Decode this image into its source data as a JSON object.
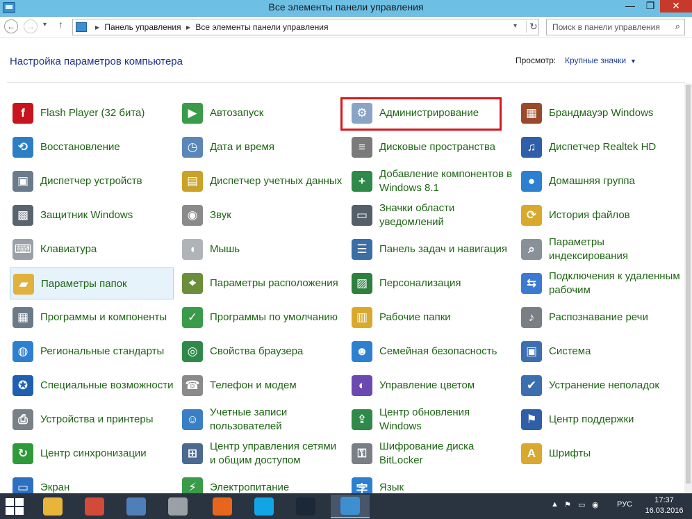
{
  "window": {
    "title": "Все элементы панели управления",
    "minimize": "—",
    "maximize": "❐",
    "close": "✕"
  },
  "nav": {
    "back": "←",
    "forward": "→",
    "recent": "▾",
    "up": "↑",
    "breadcrumb": [
      "Панель управления",
      "Все элементы панели управления"
    ],
    "breadcrumb_sep": "▸",
    "address_dropdown": "▾",
    "refresh": "↻",
    "search_placeholder": "Поиск в панели управления",
    "search_icon": "⌕"
  },
  "header": {
    "title": "Настройка параметров компьютера",
    "view_label": "Просмотр:",
    "view_value": "Крупные значки",
    "view_caret": "▼"
  },
  "items": [
    {
      "label": "Flash Player (32 бита)",
      "icon": "flash-player-icon",
      "color": "#c8141c",
      "glyph": "f"
    },
    {
      "label": "Автозапуск",
      "icon": "autoplay-icon",
      "color": "#3a9b48",
      "glyph": "▶"
    },
    {
      "label": "Администрирование",
      "icon": "administrative-tools-icon",
      "color": "#8aa4c8",
      "glyph": "⚙"
    },
    {
      "label": "Брандмауэр Windows",
      "icon": "firewall-icon",
      "color": "#9a4a2a",
      "glyph": "▦"
    },
    {
      "label": "Восстановление",
      "icon": "recovery-icon",
      "color": "#2c7fc4",
      "glyph": "⟲"
    },
    {
      "label": "Дата и время",
      "icon": "date-time-icon",
      "color": "#5a86b8",
      "glyph": "◷"
    },
    {
      "label": "Дисковые пространства",
      "icon": "storage-spaces-icon",
      "color": "#7a7a7a",
      "glyph": "≡"
    },
    {
      "label": "Диспетчер Realtek HD",
      "icon": "realtek-audio-icon",
      "color": "#2f5fa8",
      "glyph": "♫"
    },
    {
      "label": "Диспетчер устройств",
      "icon": "device-manager-icon",
      "color": "#6b7b8c",
      "glyph": "▣"
    },
    {
      "label": "Диспетчер учетных данных",
      "icon": "credential-manager-icon",
      "color": "#c9a227",
      "glyph": "▤"
    },
    {
      "label": "Добавление компонентов в Windows 8.1",
      "icon": "add-features-icon",
      "color": "#2f8a4a",
      "glyph": "+"
    },
    {
      "label": "Домашняя группа",
      "icon": "homegroup-icon",
      "color": "#2d7fd0",
      "glyph": "●"
    },
    {
      "label": "Защитник Windows",
      "icon": "windows-defender-icon",
      "color": "#5a6470",
      "glyph": "▩"
    },
    {
      "label": "Звук",
      "icon": "sound-icon",
      "color": "#8a8a8a",
      "glyph": "◉"
    },
    {
      "label": "Значки области уведомлений",
      "icon": "notification-icons-icon",
      "color": "#555f6a",
      "glyph": "▭"
    },
    {
      "label": "История файлов",
      "icon": "file-history-icon",
      "color": "#d9a92e",
      "glyph": "⟳"
    },
    {
      "label": "Клавиатура",
      "icon": "keyboard-icon",
      "color": "#9aa0a6",
      "glyph": "⌨"
    },
    {
      "label": "Мышь",
      "icon": "mouse-icon",
      "color": "#b0b4b8",
      "glyph": "◖"
    },
    {
      "label": "Панель задач и навигация",
      "icon": "taskbar-icon",
      "color": "#3a6ea5",
      "glyph": "☰"
    },
    {
      "label": "Параметры индексирования",
      "icon": "indexing-options-icon",
      "color": "#8a9098",
      "glyph": "⌕"
    },
    {
      "label": "Параметры папок",
      "icon": "folder-options-icon",
      "color": "#e0b13c",
      "glyph": "▰"
    },
    {
      "label": "Параметры расположения",
      "icon": "location-settings-icon",
      "color": "#6b8e3a",
      "glyph": "⌖"
    },
    {
      "label": "Персонализация",
      "icon": "personalization-icon",
      "color": "#2f7f3f",
      "glyph": "▨"
    },
    {
      "label": "Подключения к удаленным рабочим",
      "icon": "remote-desktop-icon",
      "color": "#3b7ad0",
      "glyph": "⇆"
    },
    {
      "label": "Программы и компоненты",
      "icon": "programs-features-icon",
      "color": "#6c7a88",
      "glyph": "▦"
    },
    {
      "label": "Программы по умолчанию",
      "icon": "default-programs-icon",
      "color": "#3a9b48",
      "glyph": "✓"
    },
    {
      "label": "Рабочие папки",
      "icon": "work-folders-icon",
      "color": "#d9a92e",
      "glyph": "▥"
    },
    {
      "label": "Распознавание речи",
      "icon": "speech-recognition-icon",
      "color": "#7a7f86",
      "glyph": "♪"
    },
    {
      "label": "Региональные стандарты",
      "icon": "region-icon",
      "color": "#2d7fd0",
      "glyph": "◍"
    },
    {
      "label": "Свойства браузера",
      "icon": "internet-options-icon",
      "color": "#2f8a4a",
      "glyph": "◎"
    },
    {
      "label": "Семейная безопасность",
      "icon": "family-safety-icon",
      "color": "#2d7fd0",
      "glyph": "☻"
    },
    {
      "label": "Система",
      "icon": "system-icon",
      "color": "#3b6fb0",
      "glyph": "▣"
    },
    {
      "label": "Специальные возможности",
      "icon": "ease-of-access-icon",
      "color": "#1f5fb0",
      "glyph": "✪"
    },
    {
      "label": "Телефон и модем",
      "icon": "phone-modem-icon",
      "color": "#8a8a8a",
      "glyph": "☎"
    },
    {
      "label": "Управление цветом",
      "icon": "color-management-icon",
      "color": "#6a4ab0",
      "glyph": "◐"
    },
    {
      "label": "Устранение неполадок",
      "icon": "troubleshooting-icon",
      "color": "#3b6fb0",
      "glyph": "✔"
    },
    {
      "label": "Устройства и принтеры",
      "icon": "devices-printers-icon",
      "color": "#7a8088",
      "glyph": "⎙"
    },
    {
      "label": "Учетные записи пользователей",
      "icon": "user-accounts-icon",
      "color": "#3a7fc4",
      "glyph": "☺"
    },
    {
      "label": "Центр обновления Windows",
      "icon": "windows-update-icon",
      "color": "#2f8a4a",
      "glyph": "⇪"
    },
    {
      "label": "Центр поддержки",
      "icon": "action-center-icon",
      "color": "#2f5fa8",
      "glyph": "⚑"
    },
    {
      "label": "Центр синхронизации",
      "icon": "sync-center-icon",
      "color": "#2f9a3a",
      "glyph": "↻"
    },
    {
      "label": "Центр управления сетями и общим доступом",
      "icon": "network-sharing-icon",
      "color": "#4a6a90",
      "glyph": "⊞"
    },
    {
      "label": "Шифрование диска BitLocker",
      "icon": "bitlocker-icon",
      "color": "#7a7f86",
      "glyph": "⚿"
    },
    {
      "label": "Шрифты",
      "icon": "fonts-icon",
      "color": "#d9a92e",
      "glyph": "A"
    },
    {
      "label": "Экран",
      "icon": "display-icon",
      "color": "#2d6fc0",
      "glyph": "▭"
    },
    {
      "label": "Электропитание",
      "icon": "power-options-icon",
      "color": "#3a9b48",
      "glyph": "⚡"
    },
    {
      "label": "Язык",
      "icon": "language-icon",
      "color": "#2d7fd0",
      "glyph": "字"
    }
  ],
  "selected_item": "Параметры папок",
  "highlighted_item": "Администрирование",
  "taskbar": {
    "apps": [
      {
        "name": "file-explorer-icon",
        "color": "#e8b53a"
      },
      {
        "name": "paint-icon",
        "color": "#d24a3a"
      },
      {
        "name": "task-manager-icon",
        "color": "#4f7fb8"
      },
      {
        "name": "sound-recorder-icon",
        "color": "#9aa0a6"
      },
      {
        "name": "firefox-icon",
        "color": "#e8661c"
      },
      {
        "name": "skype-icon",
        "color": "#12a5e6"
      },
      {
        "name": "steam-icon",
        "color": "#1b2838"
      },
      {
        "name": "control-panel-icon",
        "color": "#3d8fd0"
      }
    ],
    "tray_up": "▲",
    "tray_icons": [
      "⚑",
      "▭",
      "◉"
    ],
    "language": "РУС",
    "time": "17:37",
    "date": "16.03.2016"
  }
}
